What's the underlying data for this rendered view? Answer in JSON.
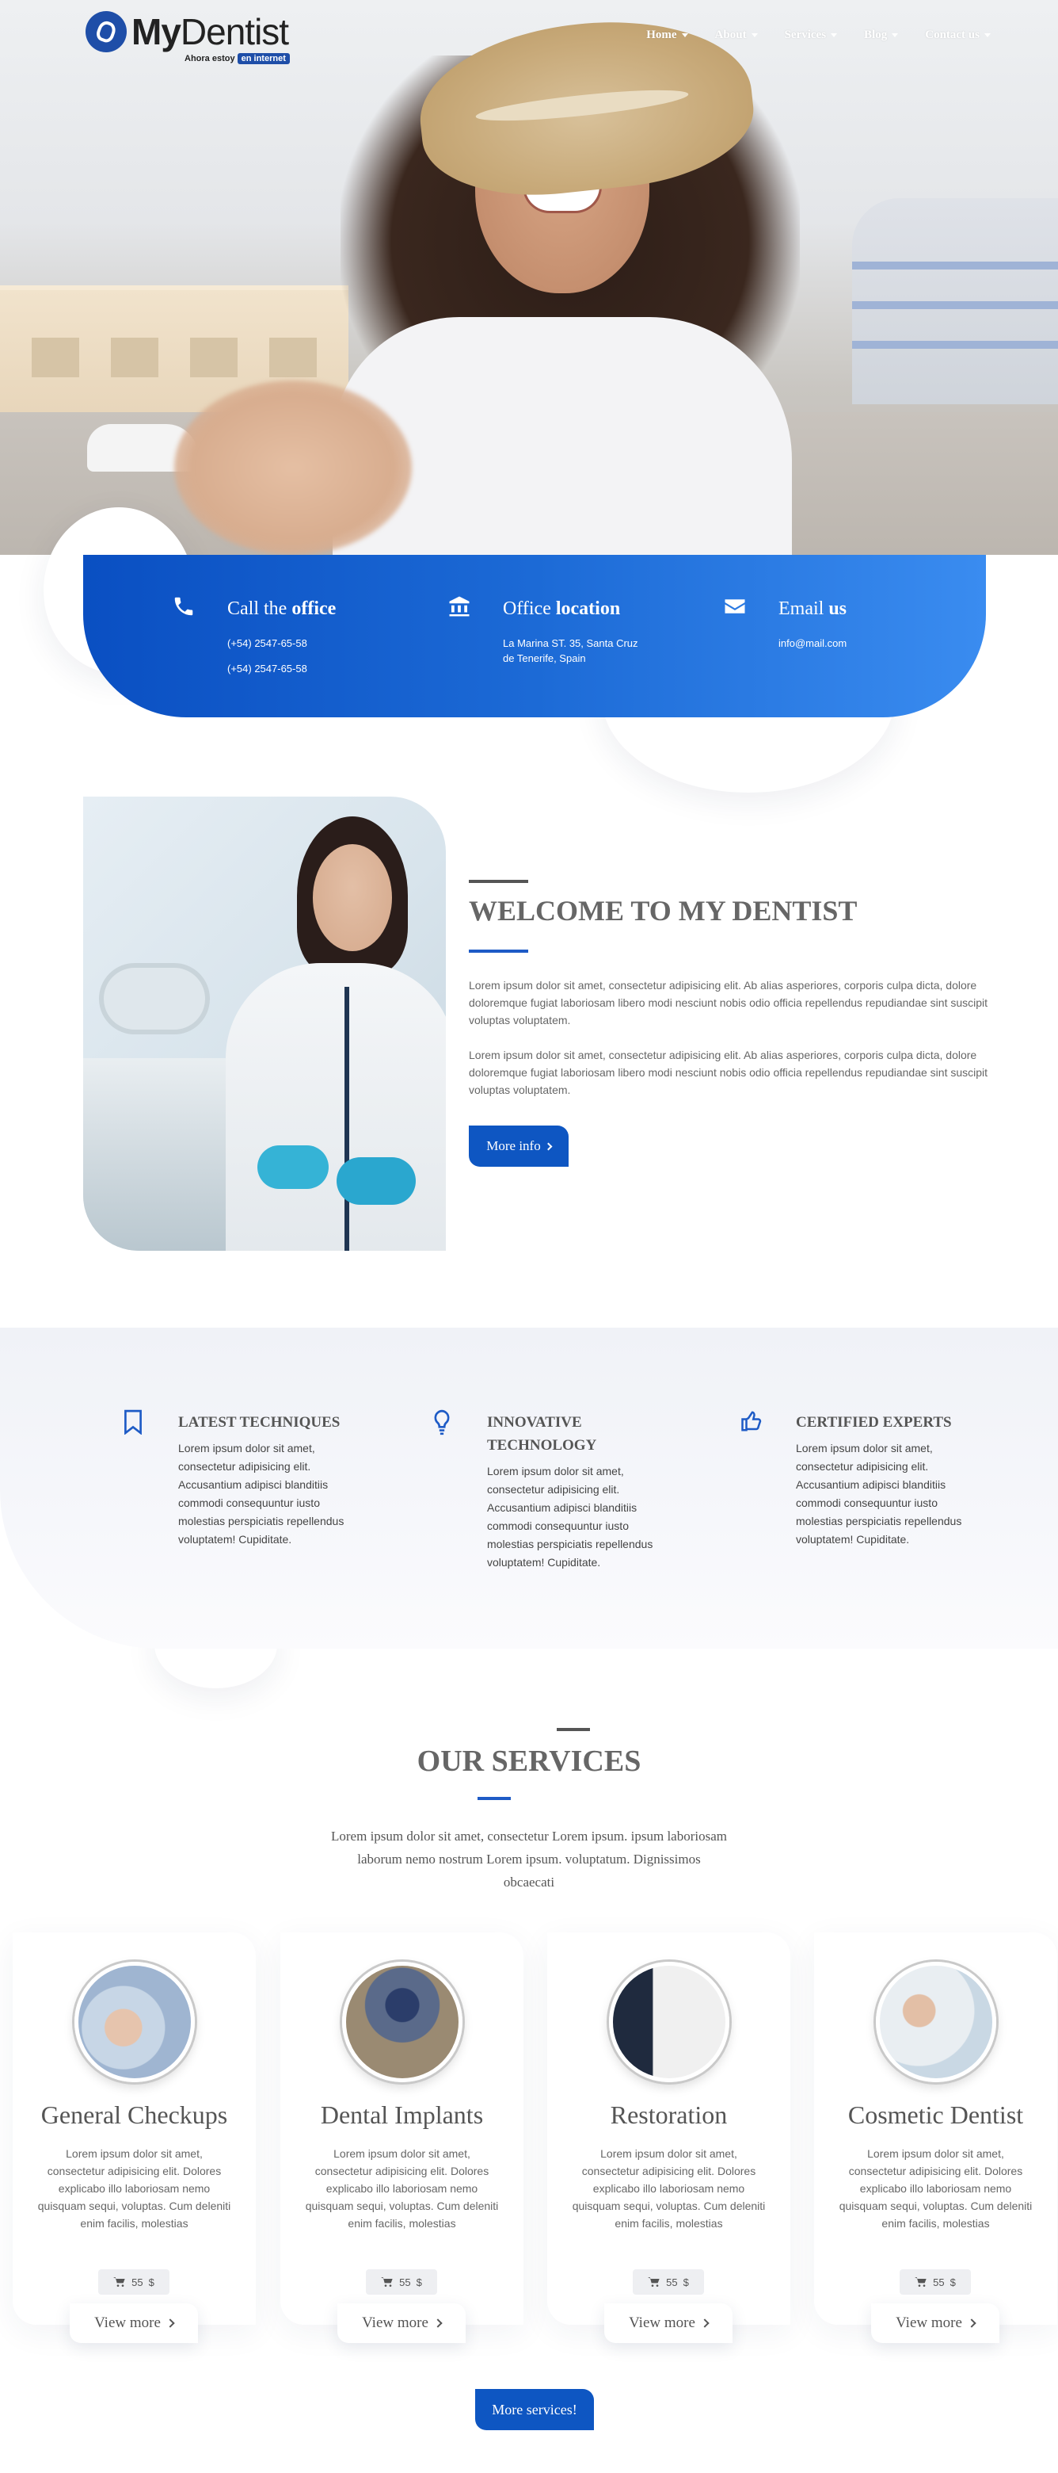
{
  "brand": {
    "logo_text_bold": "My",
    "logo_text_rest": "Dentist",
    "tagline_prefix": "Ahora estoy",
    "tagline_highlight": "en internet"
  },
  "nav": [
    {
      "label": "Home"
    },
    {
      "label": "About"
    },
    {
      "label": "Services"
    },
    {
      "label": "Blog"
    },
    {
      "label": "Contact us"
    }
  ],
  "contact": {
    "call": {
      "title_prefix": "Call the",
      "title_bold": "office",
      "line1": "(+54) 2547-65-58",
      "line2": "(+54) 2547-65-58",
      "icon": "phone-icon"
    },
    "location": {
      "title_prefix": "Office",
      "title_bold": "location",
      "line1": "La Marina ST. 35, Santa Cruz",
      "line2": "de Tenerife, Spain",
      "icon": "bank-icon"
    },
    "email": {
      "title_prefix": "Email",
      "title_bold": "us",
      "line1": "info@mail.com",
      "icon": "envelope-icon"
    }
  },
  "welcome": {
    "title_prefix": "WELCOME TO",
    "title_bold": "MY DENTIST",
    "para1": "Lorem ipsum dolor sit amet, consectetur adipisicing elit. Ab alias asperiores, corporis culpa dicta, dolore doloremque fugiat laboriosam libero modi nesciunt nobis odio officia repellendus repudiandae sint suscipit voluptas voluptatem.",
    "para2": "Lorem ipsum dolor sit amet, consectetur adipisicing elit. Ab alias asperiores, corporis culpa dicta, dolore doloremque fugiat laboriosam libero modi nesciunt nobis odio officia repellendus repudiandae sint suscipit voluptas voluptatem.",
    "button": "More info"
  },
  "features": [
    {
      "title": "LATEST TECHNIQUES",
      "icon": "bookmark-icon",
      "text": "Lorem ipsum dolor sit amet, consectetur adipisicing elit. Accusantium adipisci blanditiis commodi consequuntur iusto molestias perspiciatis repellendus voluptatem! Cupiditate."
    },
    {
      "title": "INNOVATIVE TECHNOLOGY",
      "icon": "lightbulb-icon",
      "text": "Lorem ipsum dolor sit amet, consectetur adipisicing elit. Accusantium adipisci blanditiis commodi consequuntur iusto molestias perspiciatis repellendus voluptatem! Cupiditate."
    },
    {
      "title": "CERTIFIED EXPERTS",
      "icon": "thumbs-up-icon",
      "text": "Lorem ipsum dolor sit amet, consectetur adipisicing elit. Accusantium adipisci blanditiis commodi consequuntur iusto molestias perspiciatis repellendus voluptatem! Cupiditate."
    }
  ],
  "services": {
    "title_prefix": "OUR",
    "title_bold": "SERVICES",
    "intro": "Lorem ipsum dolor sit amet, consectetur Lorem ipsum. ipsum laboriosam laborum nemo nostrum Lorem ipsum. voluptatum. Dignissimos obcaecati",
    "cards": [
      {
        "title": "General Checkups",
        "text": "Lorem ipsum dolor sit amet, consectetur adipisicing elit. Dolores explicabo illo laboriosam nemo quisquam sequi, voluptas. Cum deleniti enim facilis, molestias",
        "price": "55",
        "currency": "$",
        "button": "View more"
      },
      {
        "title": "Dental Implants",
        "text": "Lorem ipsum dolor sit amet, consectetur adipisicing elit. Dolores explicabo illo laboriosam nemo quisquam sequi, voluptas. Cum deleniti enim facilis, molestias",
        "price": "55",
        "currency": "$",
        "button": "View more"
      },
      {
        "title": "Restoration",
        "text": "Lorem ipsum dolor sit amet, consectetur adipisicing elit. Dolores explicabo illo laboriosam nemo quisquam sequi, voluptas. Cum deleniti enim facilis, molestias",
        "price": "55",
        "currency": "$",
        "button": "View more"
      },
      {
        "title": "Cosmetic Dentist",
        "text": "Lorem ipsum dolor sit amet, consectetur adipisicing elit. Dolores explicabo illo laboriosam nemo quisquam sequi, voluptas. Cum deleniti enim facilis, molestias",
        "price": "55",
        "currency": "$",
        "button": "View more"
      }
    ],
    "more_button": "More services!"
  },
  "colors": {
    "primary": "#0e56c2",
    "gradient_end": "#3a8cf0",
    "text": "#555555"
  }
}
